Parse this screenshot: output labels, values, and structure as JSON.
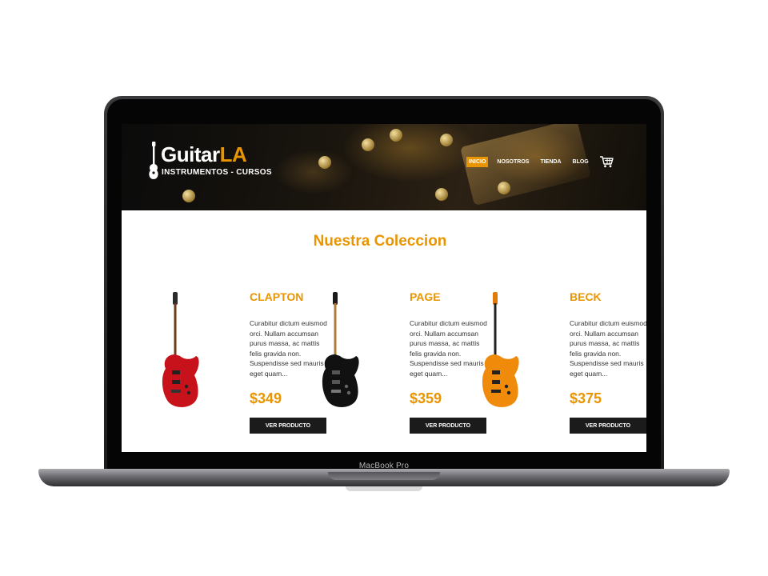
{
  "device": {
    "label": "MacBook Pro"
  },
  "site": {
    "brand": {
      "name_main": "Guitar",
      "name_accent": "LA",
      "tagline": "INSTRUMENTOS - CURSOS"
    },
    "nav": [
      {
        "label": "INICIO",
        "active": true
      },
      {
        "label": "NOSOTROS",
        "active": false
      },
      {
        "label": "TIENDA",
        "active": false
      },
      {
        "label": "BLOG",
        "active": false
      }
    ],
    "cart_icon": "shopping-cart-icon",
    "colors": {
      "accent": "#e99401",
      "dark": "#1b1b1b",
      "text": "#333333"
    }
  },
  "main": {
    "title": "Nuestra Coleccion",
    "products": [
      {
        "name": "CLAPTON",
        "description": "Curabitur dictum euismod orci. Nullam accumsan purus massa, ac mattis felis gravida non. Suspendisse sed mauris eget quam...",
        "price": "$349",
        "button_label": "VER PRODUCTO",
        "guitar_color": "#c8121b"
      },
      {
        "name": "PAGE",
        "description": "Curabitur dictum euismod orci. Nullam accumsan purus massa, ac mattis felis gravida non. Suspendisse sed mauris eget quam...",
        "price": "$359",
        "button_label": "VER PRODUCTO",
        "guitar_color": "#111111"
      },
      {
        "name": "BECK",
        "description": "Curabitur dictum euismod orci. Nullam accumsan purus massa, ac mattis felis gravida non. Suspendisse sed mauris eget quam...",
        "price": "$375",
        "button_label": "VER PRODUCTO",
        "guitar_color": "#f08a0a"
      }
    ]
  }
}
